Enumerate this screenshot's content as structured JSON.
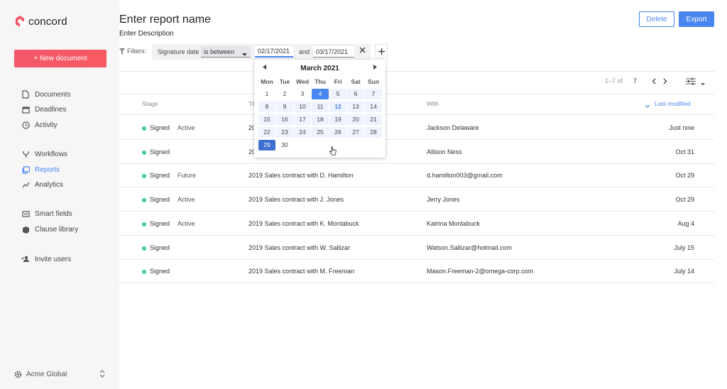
{
  "app": {
    "brand": "concord",
    "new_document": "+ New document",
    "workspace": "Acme Global"
  },
  "nav": {
    "documents": "Documents",
    "deadlines": "Deadlines",
    "activity": "Activity",
    "workflows": "Workflows",
    "reports": "Reports",
    "analytics": "Analytics",
    "smart_fields": "Smart fields",
    "clause_library": "Clause library",
    "invite_users": "Invite users"
  },
  "report": {
    "title": "Enter report name",
    "description": "Enter Description",
    "delete": "Delete",
    "export": "Export"
  },
  "filters": {
    "label": "Filters:",
    "field": "Signature date",
    "operator": "is between",
    "from": "02/17/2021",
    "and": "and",
    "to": "03/17/2021"
  },
  "pager": {
    "range": "1–7 of",
    "total": "7"
  },
  "columns": {
    "stage": "Stage",
    "title": "Title",
    "with": "With",
    "last_modified": "Last modified"
  },
  "rows": [
    {
      "stage": "Signed",
      "status": "Active",
      "title": "2019 Sales contract with B. Delaware",
      "with": "Jackson Delaware",
      "modified": "Just now"
    },
    {
      "stage": "Signed",
      "status": "",
      "title": "2019 Sales contract with A. Ness",
      "with": "Allison Ness",
      "modified": "Oct 31"
    },
    {
      "stage": "Signed",
      "status": "Future",
      "title": "2019 Sales contract with D. Hamilton",
      "with": "d.hamilton003@gmail.com",
      "modified": "Oct 29"
    },
    {
      "stage": "Signed",
      "status": "Active",
      "title": "2019 Sales contract with J. Jones",
      "with": "Jerry Jones",
      "modified": "Oct 29"
    },
    {
      "stage": "Signed",
      "status": "Active",
      "title": "2019 Sales contract with K. Montabuck",
      "with": "Katrina Montabuck",
      "modified": "Aug 4"
    },
    {
      "stage": "Signed",
      "status": "",
      "title": "2019 Sales contract with W. Sallizar",
      "with": "Watson.Sallizar@hotmail.com",
      "modified": "July 15"
    },
    {
      "stage": "Signed",
      "status": "",
      "title": "2019 Sales contract with M. Freeman",
      "with": "Mason.Freeman-2@omega-corp.com",
      "modified": "July 14"
    }
  ],
  "calendar": {
    "month": "March 2021",
    "dow": [
      "Mon",
      "Tue",
      "Wed",
      "Thu",
      "Fri",
      "Sat",
      "Sun"
    ],
    "first_weekday": 0,
    "days_in_month": 31,
    "start_day": 1,
    "selected_start": 4,
    "selected_end": 29,
    "today": 12,
    "last_shown_day": 30
  },
  "colors": {
    "accent": "#4a86f0",
    "danger": "#f2576a",
    "signed_dot": "#3ccc9e"
  }
}
